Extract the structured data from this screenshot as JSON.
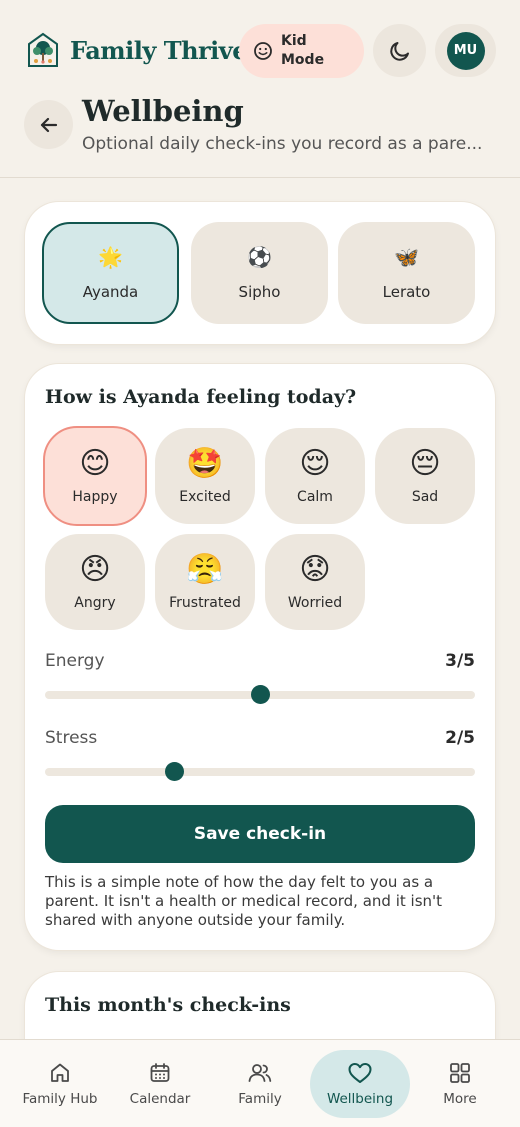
{
  "header": {
    "brand_name": "Family Thrive",
    "kid_mode_label": "Kid Mode",
    "avatar_initials": "MU"
  },
  "page": {
    "title": "Wellbeing",
    "subtitle": "Optional daily check-ins you record as a pare..."
  },
  "children": [
    {
      "name": "Ayanda",
      "emoji": "🌟",
      "selected": true
    },
    {
      "name": "Sipho",
      "emoji": "⚽",
      "selected": false
    },
    {
      "name": "Lerato",
      "emoji": "🦋",
      "selected": false
    }
  ],
  "checkin": {
    "heading": "How is Ayanda feeling today?",
    "moods": [
      {
        "label": "Happy",
        "emoji": "😊",
        "selected": true
      },
      {
        "label": "Excited",
        "emoji": "🤩",
        "selected": false
      },
      {
        "label": "Calm",
        "emoji": "😌",
        "selected": false
      },
      {
        "label": "Sad",
        "emoji": "😔",
        "selected": false
      },
      {
        "label": "Angry",
        "emoji": "😠",
        "selected": false
      },
      {
        "label": "Frustrated",
        "emoji": "😤",
        "selected": false
      },
      {
        "label": "Worried",
        "emoji": "😟",
        "selected": false
      }
    ],
    "energy": {
      "label": "Energy",
      "value_text": "3/5",
      "value": 3,
      "max": 5
    },
    "stress": {
      "label": "Stress",
      "value_text": "2/5",
      "value": 2,
      "max": 5
    },
    "save_label": "Save check-in",
    "note": "This is a simple note of how the day felt to you as a parent. It isn't a health or medical record, and it isn't shared with anyone outside your family."
  },
  "month": {
    "heading": "This month's check-ins"
  },
  "nav": [
    {
      "label": "Family Hub",
      "icon": "home-icon",
      "active": false
    },
    {
      "label": "Calendar",
      "icon": "calendar-icon",
      "active": false
    },
    {
      "label": "Family",
      "icon": "people-icon",
      "active": false
    },
    {
      "label": "Wellbeing",
      "icon": "heart-icon",
      "active": true
    },
    {
      "label": "More",
      "icon": "grid-icon",
      "active": false
    }
  ],
  "colors": {
    "primary": "#12564f",
    "accent_soft": "#d4e8e8",
    "kid_mode_bg": "#fde0d8",
    "mood_active_border": "#ef8f82",
    "background": "#f5f1ea"
  }
}
